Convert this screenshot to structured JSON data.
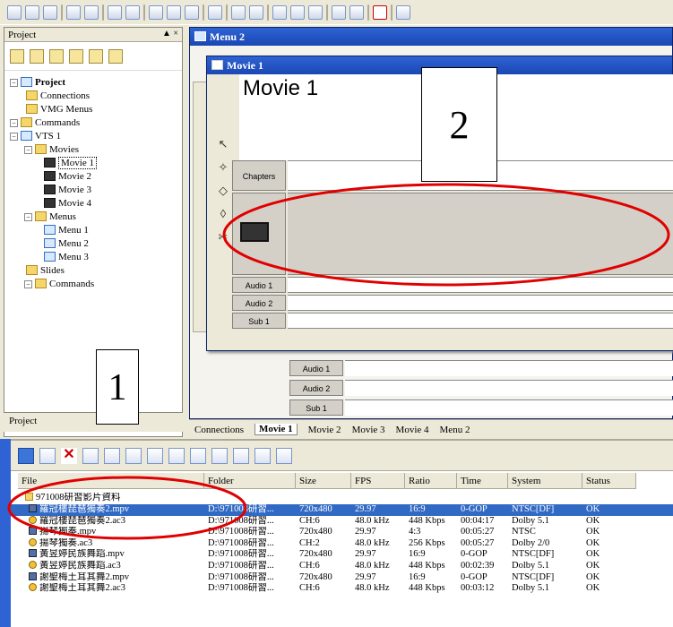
{
  "project": {
    "title": "Project",
    "close": "▲ ×",
    "tree": [
      {
        "label": "Project",
        "type": "root"
      },
      {
        "label": "Connections",
        "type": "conn"
      },
      {
        "label": "VMG Menus",
        "type": "folder"
      },
      {
        "label": "Commands",
        "type": "folder"
      },
      {
        "label": "VTS 1",
        "type": "vts"
      },
      {
        "label": "Movies",
        "type": "folder"
      },
      {
        "label": "Movie 1",
        "type": "film"
      },
      {
        "label": "Movie 2",
        "type": "film"
      },
      {
        "label": "Movie 3",
        "type": "film"
      },
      {
        "label": "Movie 4",
        "type": "film"
      },
      {
        "label": "Menus",
        "type": "folder"
      },
      {
        "label": "Menu 1",
        "type": "menu"
      },
      {
        "label": "Menu 2",
        "type": "menu"
      },
      {
        "label": "Menu 3",
        "type": "menu"
      },
      {
        "label": "Slides",
        "type": "folder"
      },
      {
        "label": "Commands",
        "type": "folder"
      }
    ],
    "tab": "Project"
  },
  "annotations": {
    "label1": "1",
    "label2": "2"
  },
  "menu2": {
    "title": "Menu 2"
  },
  "movie1": {
    "title": "Movie 1",
    "heading": "Movie 1",
    "tracks": {
      "chapters": "Chapters",
      "audio1": "Audio 1",
      "audio2": "Audio 2",
      "sub1": "Sub 1"
    }
  },
  "lower_tracks": {
    "audio1": "Audio 1",
    "audio2": "Audio 2",
    "sub1": "Sub 1"
  },
  "tabs": [
    "Connections",
    "Movie 1",
    "Movie 2",
    "Movie 3",
    "Movie 4",
    "Menu 2"
  ],
  "assets": {
    "headers": [
      "File",
      "Folder",
      "Size",
      "FPS",
      "Ratio",
      "Time",
      "System",
      "Status"
    ],
    "group": "971008研習影片資料",
    "rows": [
      {
        "icon": "mpv",
        "file": "羅冠樓琵琶獨奏2.mpv",
        "folder": "D:\\971008研習...",
        "size": "720x480",
        "fps": "29.97",
        "ratio": "16:9",
        "time": "0-GOP",
        "system": "NTSC[DF]",
        "status": "OK",
        "selected": true
      },
      {
        "icon": "ac3",
        "file": "羅冠樓琵琶獨奏2.ac3",
        "folder": "D:\\971008研習...",
        "size": "CH:6",
        "fps": "48.0 kHz",
        "ratio": "448 Kbps",
        "time": "00:04:17",
        "system": "Dolby 5.1",
        "status": "OK",
        "selected": false
      },
      {
        "icon": "mpv",
        "file": "揚琴獨奏.mpv",
        "folder": "D:\\971008研習...",
        "size": "720x480",
        "fps": "29.97",
        "ratio": "4:3",
        "time": "00:05:27",
        "system": "NTSC",
        "status": "OK",
        "selected": false
      },
      {
        "icon": "ac3",
        "file": "揚琴獨奏.ac3",
        "folder": "D:\\971008研習...",
        "size": "CH:2",
        "fps": "48.0 kHz",
        "ratio": "256 Kbps",
        "time": "00:05:27",
        "system": "Dolby 2/0",
        "status": "OK",
        "selected": false
      },
      {
        "icon": "mpv",
        "file": "黃昱婷民族舞蹈.mpv",
        "folder": "D:\\971008研習...",
        "size": "720x480",
        "fps": "29.97",
        "ratio": "16:9",
        "time": "0-GOP",
        "system": "NTSC[DF]",
        "status": "OK",
        "selected": false
      },
      {
        "icon": "ac3",
        "file": "黃昱婷民族舞蹈.ac3",
        "folder": "D:\\971008研習...",
        "size": "CH:6",
        "fps": "48.0 kHz",
        "ratio": "448 Kbps",
        "time": "00:02:39",
        "system": "Dolby 5.1",
        "status": "OK",
        "selected": false
      },
      {
        "icon": "mpv",
        "file": "謝聖梅土耳其舞2.mpv",
        "folder": "D:\\971008研習...",
        "size": "720x480",
        "fps": "29.97",
        "ratio": "16:9",
        "time": "0-GOP",
        "system": "NTSC[DF]",
        "status": "OK",
        "selected": false
      },
      {
        "icon": "ac3",
        "file": "謝聖梅土耳其舞2.ac3",
        "folder": "D:\\971008研習...",
        "size": "CH:6",
        "fps": "48.0 kHz",
        "ratio": "448 Kbps",
        "time": "00:03:12",
        "system": "Dolby 5.1",
        "status": "OK",
        "selected": false
      }
    ]
  },
  "colors": {
    "selection": "#316ac5",
    "annotation_ellipse": "#e00000",
    "titlebar": "#2f63d3"
  }
}
